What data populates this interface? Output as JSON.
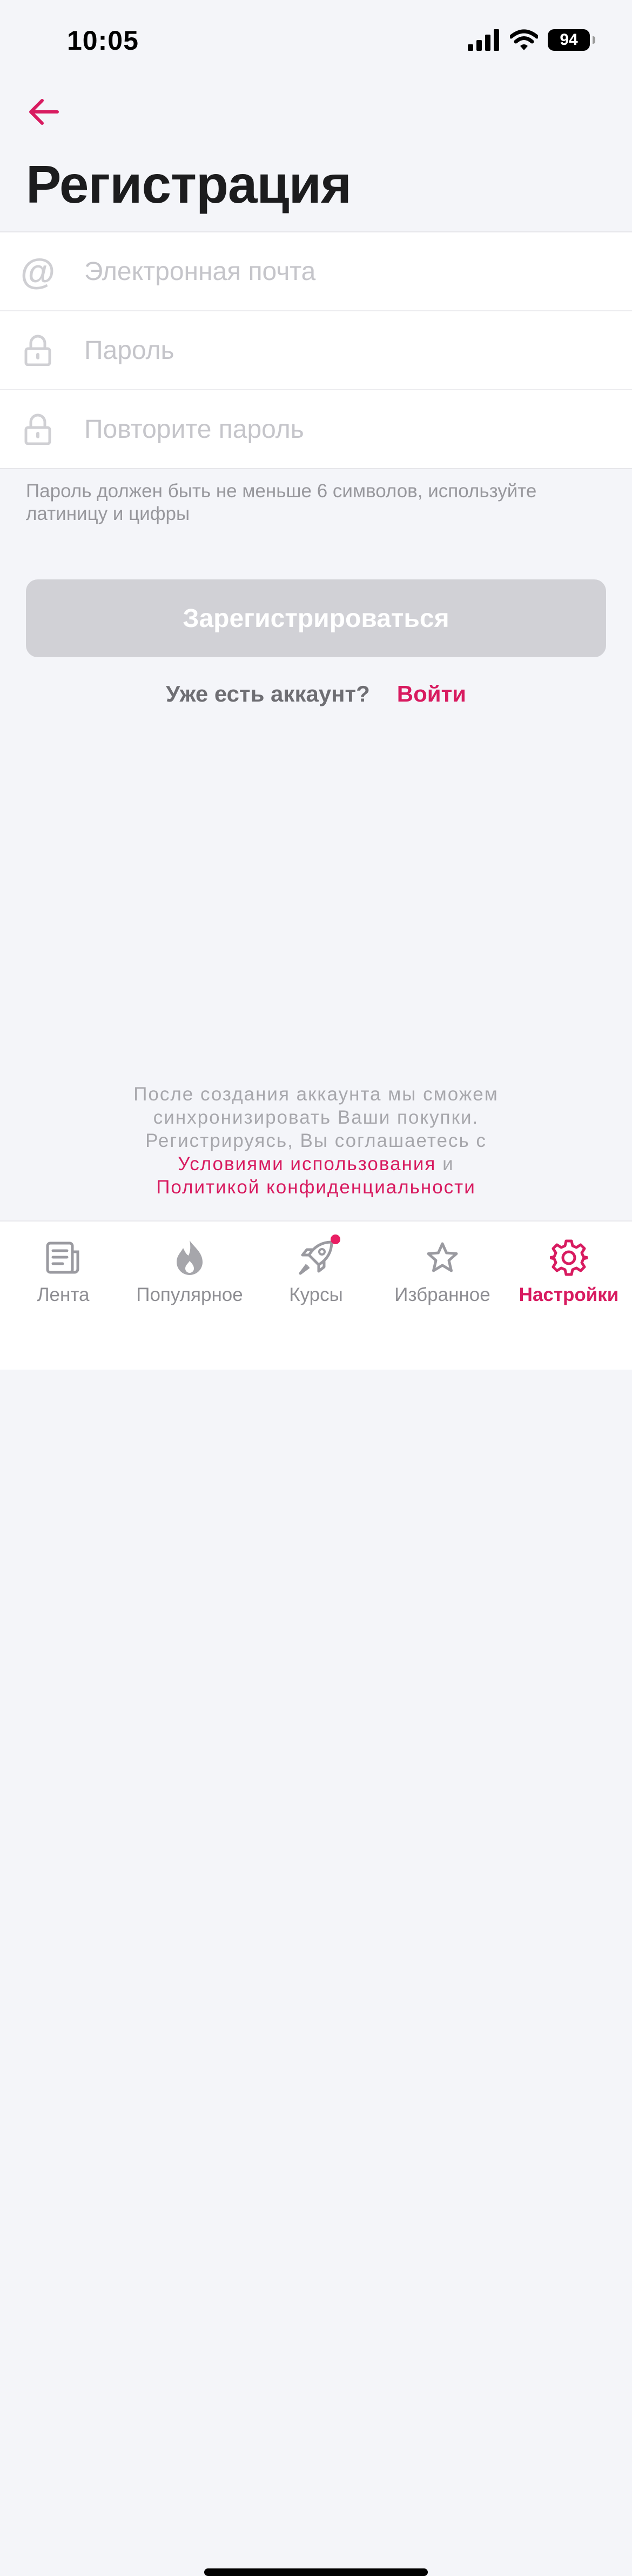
{
  "status_bar": {
    "time": "10:05",
    "battery": "94"
  },
  "header": {
    "title": "Регистрация"
  },
  "form": {
    "email": {
      "placeholder": "Электронная почта",
      "value": ""
    },
    "password": {
      "placeholder": "Пароль",
      "value": ""
    },
    "confirm_password": {
      "placeholder": "Повторите пароль",
      "value": ""
    }
  },
  "hint": "Пароль должен быть не меньше 6 символов, используйте латиницу и цифры",
  "register_button": {
    "label": "Зарегистрироваться",
    "enabled": false
  },
  "login": {
    "question": "Уже есть аккаунт?",
    "link": "Войти"
  },
  "terms": {
    "line1": "После создания аккаунта мы сможем",
    "line2": "синхронизировать Ваши покупки.",
    "line3": "Регистрируясь, Вы соглашаетесь с",
    "terms_link": "Условиями использования",
    "conjunction": "и",
    "privacy_link": "Политикой конфиденциальности"
  },
  "tabs": [
    {
      "label": "Лента",
      "icon": "newspaper-icon",
      "active": false
    },
    {
      "label": "Популярное",
      "icon": "flame-icon",
      "active": false
    },
    {
      "label": "Курсы",
      "icon": "rocket-icon",
      "active": false,
      "badge": true
    },
    {
      "label": "Избранное",
      "icon": "star-icon",
      "active": false
    },
    {
      "label": "Настройки",
      "icon": "gear-icon",
      "active": true
    }
  ],
  "colors": {
    "accent": "#d81b60",
    "background": "#f4f5f9",
    "disabled_button": "#d1d1d6",
    "placeholder": "#c5c5ca"
  }
}
